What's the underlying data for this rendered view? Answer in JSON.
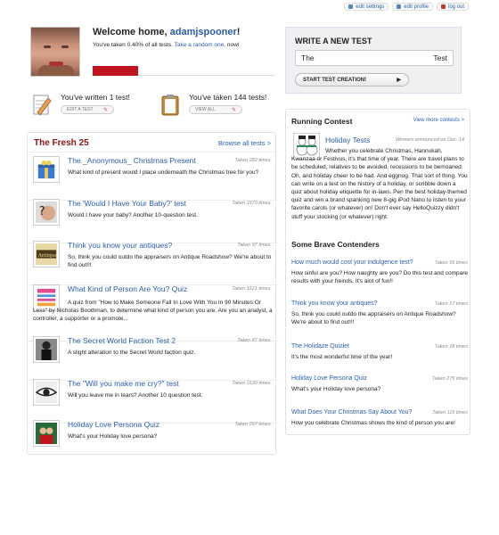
{
  "topnav": {
    "edit_settings": "edit settings",
    "edit_profile": "edit profile",
    "log_out": "log out"
  },
  "welcome": {
    "greeting": "Welcome home, ",
    "username": "adamjspooner",
    "exclaim": "!",
    "taken_prefix": "You've taken 0.40% of all tests. ",
    "random_link": "Take a random one",
    "taken_suffix": ", now!",
    "progress_fraction": 0.25
  },
  "stats": {
    "written_label": "You've written 1 test!",
    "edit_button": "EDIT A TEST",
    "taken_label": "You've taken 144 tests!",
    "view_button": "VIEW ALL"
  },
  "fresh": {
    "title": "The Fresh 25",
    "browse": "Browse all tests >",
    "entries": [
      {
        "title": "The _Anonymous_ Christmas Present",
        "taken": "Taken 282 times.",
        "desc": "What kind of present would I place underneath the Christmas tree for you?"
      },
      {
        "title": "The 'Would I Have Your Baby?' test",
        "taken": "Taken 1970 times.",
        "desc": "Would I have your baby? Another 10-question test."
      },
      {
        "title": "Think you know your antiques?",
        "taken": "Taken 97 times.",
        "desc": "So, think you could outdo the appraisers on Antique Roadshow?  We're about to find out!!!"
      },
      {
        "title": "What Kind of Person Are You? Quiz",
        "taken": "Taken 3121 times.",
        "desc": "A quiz from \"How to Make Someone Fall In Love With You In 90 Minutes Or Less\" by Nicholas Boothman, to determine what kind of person you are. Are you an analyst, a controller, a supporter or a promote..."
      },
      {
        "title": "The Secret World Faction Test 2",
        "taken": "Taken 87 times.",
        "desc": "A slight alteration to the Secret World faction quiz."
      },
      {
        "title": "The \"Will you make me cry?\" test",
        "taken": "Taken 1530 times.",
        "desc": "Will you leave me in tears? Another 10 question test."
      },
      {
        "title": "Holiday Love Persona Quiz",
        "taken": "Taken 297 times.",
        "desc": "What's your Holiday love persona?"
      }
    ]
  },
  "newtest": {
    "title": "WRITE A NEW TEST",
    "input_left": "The",
    "input_right": "Test",
    "button": "START TEST CREATION!"
  },
  "contest": {
    "title": "Running Contest",
    "more": "View more contests >",
    "name": "Holiday Tests",
    "announced": "Winners announced on Dec. 14",
    "desc": "Whether you celebrate Christmas, Hannukah, Kwanzaa or Festivus, it's that time of year. There are travel plans to be scheduled, relatives to be avoided, recessions to be bemoaned. Oh, and holiday cheer to be had. And eggnog. That sort of thing. You can write on a test on the history of a holiday, or scribble down a quiz about holiday etiquette for in-laws. Pen the best holiday-themed quiz and win a brand spanking new 8-gig iPod Nano to listen to your favorite carols (or whatever) on! Don't ever say HelloQuizzy didn't stuff your stocking (or whatever) right."
  },
  "brave": {
    "title": "Some Brave Contenders",
    "items": [
      {
        "title": "How much would cost your indulgence test?",
        "taken": "Taken 55 times",
        "desc": "How sinful are you? How naughty are you? Do this test and compare results with your freinds. It's alot of fun!!"
      },
      {
        "title": "Think you know your antiques?",
        "taken": "Taken 17 times",
        "desc": "So, think you could outdo the appraisers on Antique Roadshow?  We're about to find out!!!"
      },
      {
        "title": "The Holidaze Quizlet",
        "taken": "Taken 18 times",
        "desc": "It's the most wonderful time of the year!"
      },
      {
        "title": "Holiday Love Persona Quiz",
        "taken": "Taken 275 times",
        "desc": "What's your Holiday love persona?"
      },
      {
        "title": "What Does Your Christmas Say About You?",
        "taken": "Taken 115 times",
        "desc": "How you celebrate Christmas shows the kind of person you are!"
      }
    ]
  },
  "colors": {
    "link": "#2a5db0",
    "fresh_title": "#8b1414",
    "progress": "#c0141e"
  }
}
